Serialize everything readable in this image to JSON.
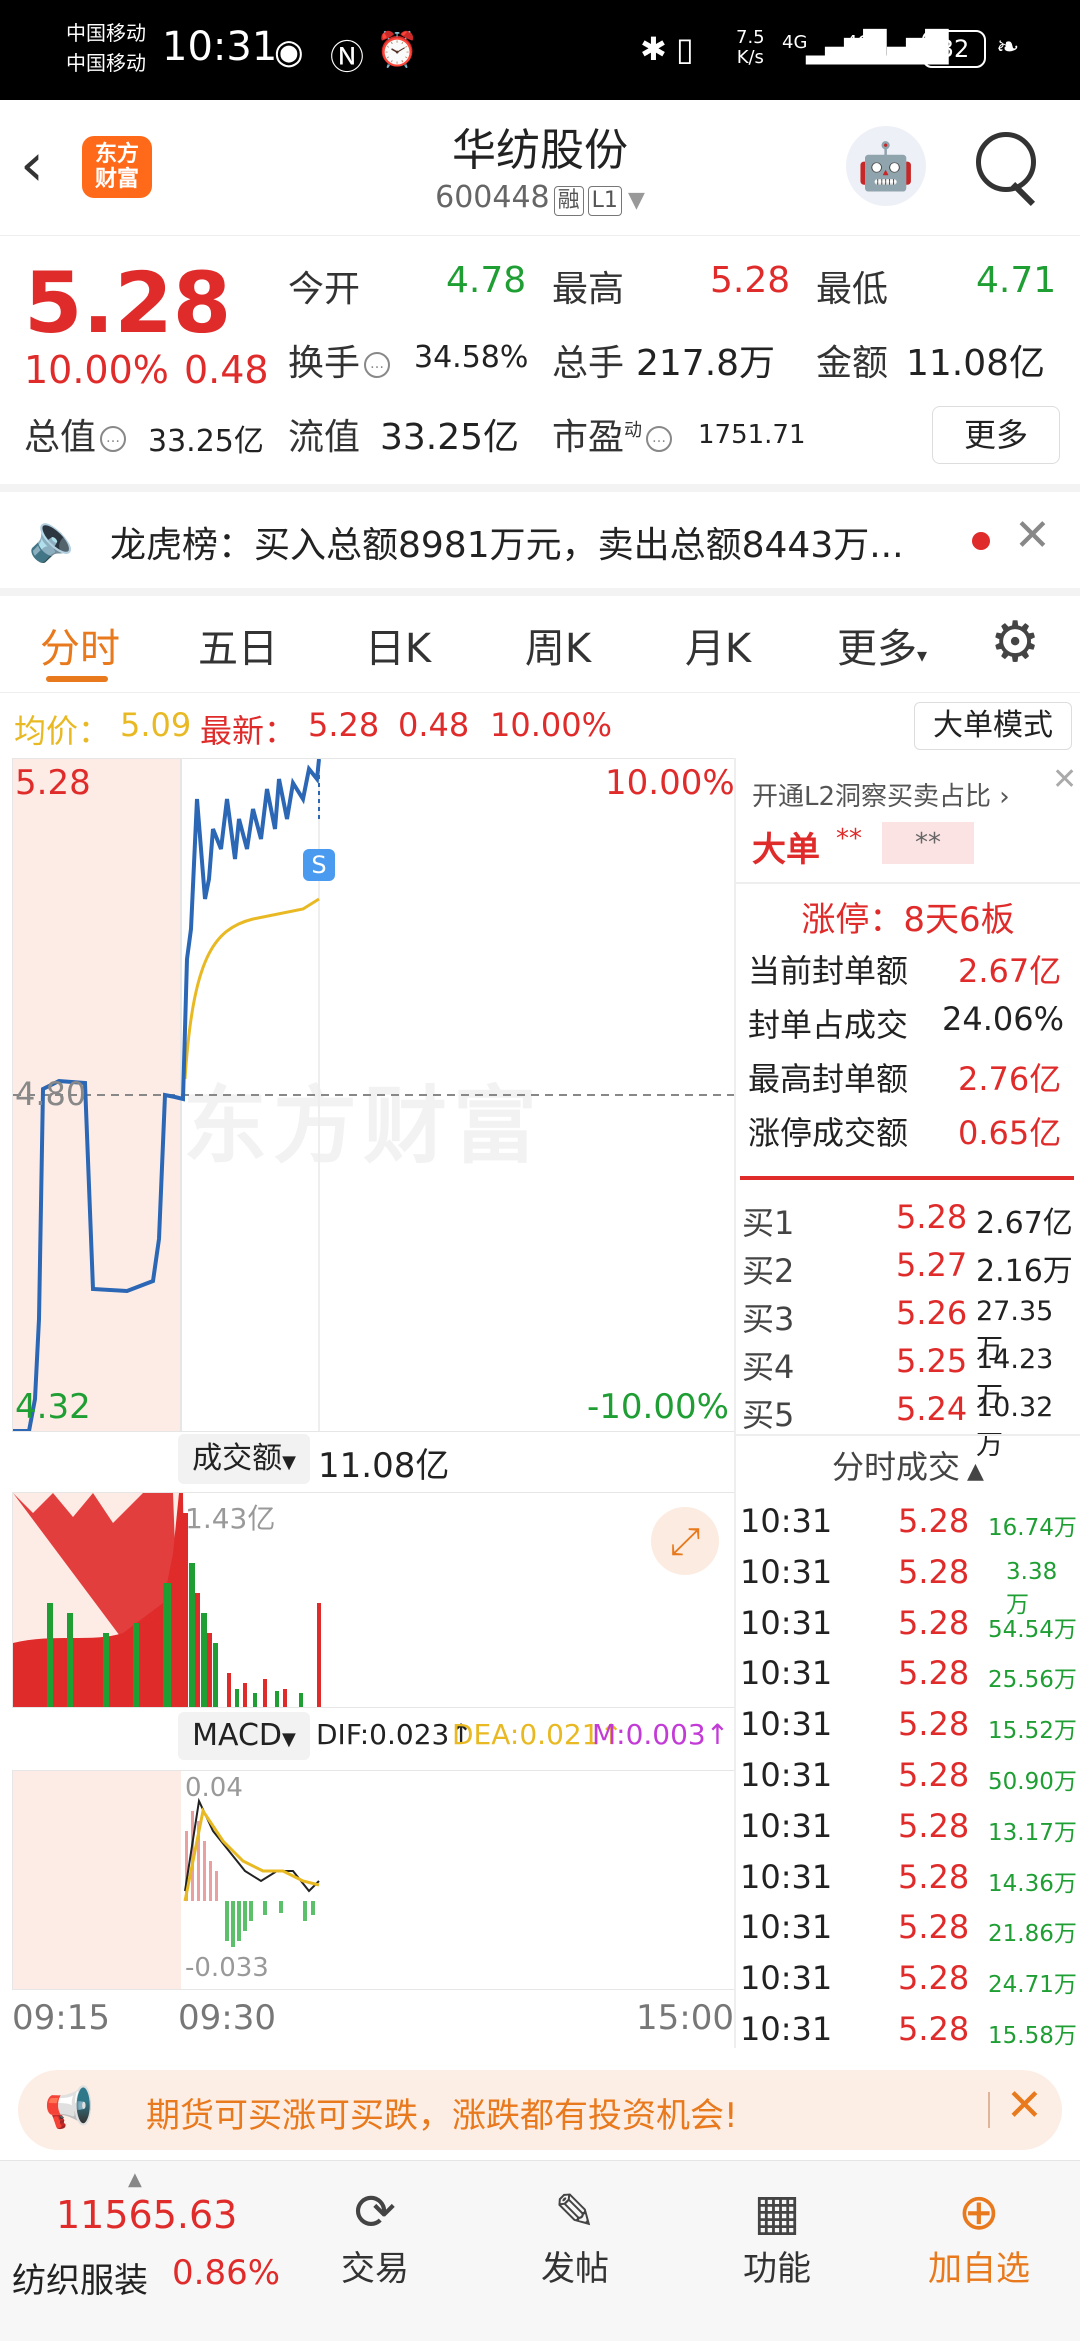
{
  "status_bar": {
    "carrier1": "中国移动",
    "carrier2": "中国移动",
    "time": "10:31",
    "net_speed_top": "7.5",
    "net_speed_bottom": "K/s",
    "signal_label": "4G",
    "battery": "32"
  },
  "header": {
    "logo_line1": "东方",
    "logo_line2": "财富",
    "stock_name": "华纺股份",
    "stock_code": "600448",
    "tag_rong": "融",
    "tag_l1": "L1"
  },
  "quote": {
    "price": "5.28",
    "change_pct": "10.00%",
    "change": "0.48",
    "open_label": "今开",
    "open": "4.78",
    "high_label": "最高",
    "high": "5.28",
    "low_label": "最低",
    "low": "4.71",
    "turnover_label": "换手",
    "turnover": "34.58%",
    "volume_label": "总手",
    "volume": "217.8万",
    "amount_label": "金额",
    "amount": "11.08亿",
    "total_cap_label": "总值",
    "total_cap": "33.25亿",
    "float_cap_label": "流值",
    "float_cap": "33.25亿",
    "pe_label": "市盈",
    "pe_super": "动",
    "pe": "1751.71",
    "more": "更多"
  },
  "notice": {
    "text": "龙虎榜：买入总额8981万元，卖出总额8443万..."
  },
  "tabs": [
    "分时",
    "五日",
    "日K",
    "周K",
    "月K",
    "更多"
  ],
  "info_line": {
    "avg_label": "均价：",
    "avg": "5.09",
    "latest_label": "最新：",
    "latest": "5.28",
    "chg": "0.48",
    "pct": "10.00%",
    "mode_button": "大单模式"
  },
  "chart": {
    "y_top": "5.28",
    "y_mid": "4.80",
    "y_bottom": "4.32",
    "pct_top": "10.00%",
    "pct_bottom": "-10.00%",
    "watermark": "东方财富",
    "s_marker": "S"
  },
  "volume_panel": {
    "selector": "成交额",
    "total": "11.08亿",
    "max_label": "1.43亿"
  },
  "macd_panel": {
    "selector": "MACD",
    "dif": "DIF:0.023↑",
    "dea": "DEA:0.021↑",
    "m": "M:0.003↑",
    "top": "0.04",
    "bottom": "-0.033"
  },
  "time_axis": [
    "09:15",
    "09:30",
    "15:00"
  ],
  "side": {
    "l2_link": "开通L2洞察买卖占比",
    "big_label": "大单",
    "big_val1": "**",
    "big_val2": "**",
    "limit_title": "涨停：8天6板",
    "rows": [
      {
        "label": "当前封单额",
        "value": "2.67亿"
      },
      {
        "label": "封单占成交",
        "value": "24.06%"
      },
      {
        "label": "最高封单额",
        "value": "2.76亿"
      },
      {
        "label": "涨停成交额",
        "value": "0.65亿"
      }
    ],
    "bids": [
      {
        "label": "买1",
        "price": "5.28",
        "vol": "2.67亿"
      },
      {
        "label": "买2",
        "price": "5.27",
        "vol": "2.16万"
      },
      {
        "label": "买3",
        "price": "5.26",
        "vol": "27.35万"
      },
      {
        "label": "买4",
        "price": "5.25",
        "vol": "14.23万"
      },
      {
        "label": "买5",
        "price": "5.24",
        "vol": "10.32万"
      }
    ],
    "trades_title": "分时成交",
    "trades": [
      {
        "t": "10:31",
        "p": "5.28",
        "v": "16.74万"
      },
      {
        "t": "10:31",
        "p": "5.28",
        "v": "3.38万"
      },
      {
        "t": "10:31",
        "p": "5.28",
        "v": "54.54万"
      },
      {
        "t": "10:31",
        "p": "5.28",
        "v": "25.56万"
      },
      {
        "t": "10:31",
        "p": "5.28",
        "v": "15.52万"
      },
      {
        "t": "10:31",
        "p": "5.28",
        "v": "50.90万"
      },
      {
        "t": "10:31",
        "p": "5.28",
        "v": "13.17万"
      },
      {
        "t": "10:31",
        "p": "5.28",
        "v": "14.36万"
      },
      {
        "t": "10:31",
        "p": "5.28",
        "v": "21.86万"
      },
      {
        "t": "10:31",
        "p": "5.28",
        "v": "24.71万"
      },
      {
        "t": "10:31",
        "p": "5.28",
        "v": "15.58万"
      }
    ]
  },
  "banner": {
    "text": "期货可买涨可买跌，涨跌都有投资机会!"
  },
  "bottom_nav": {
    "index_value": "11565.63",
    "index_name": "纺织服装",
    "index_pct": "0.86%",
    "items": [
      "交易",
      "发帖",
      "功能",
      "加自选"
    ]
  },
  "colors": {
    "up": "#e02b2b",
    "down": "#1e9e33",
    "accent": "#e8791d",
    "price_line": "#2b67b5",
    "avg_line": "#e8b923"
  }
}
